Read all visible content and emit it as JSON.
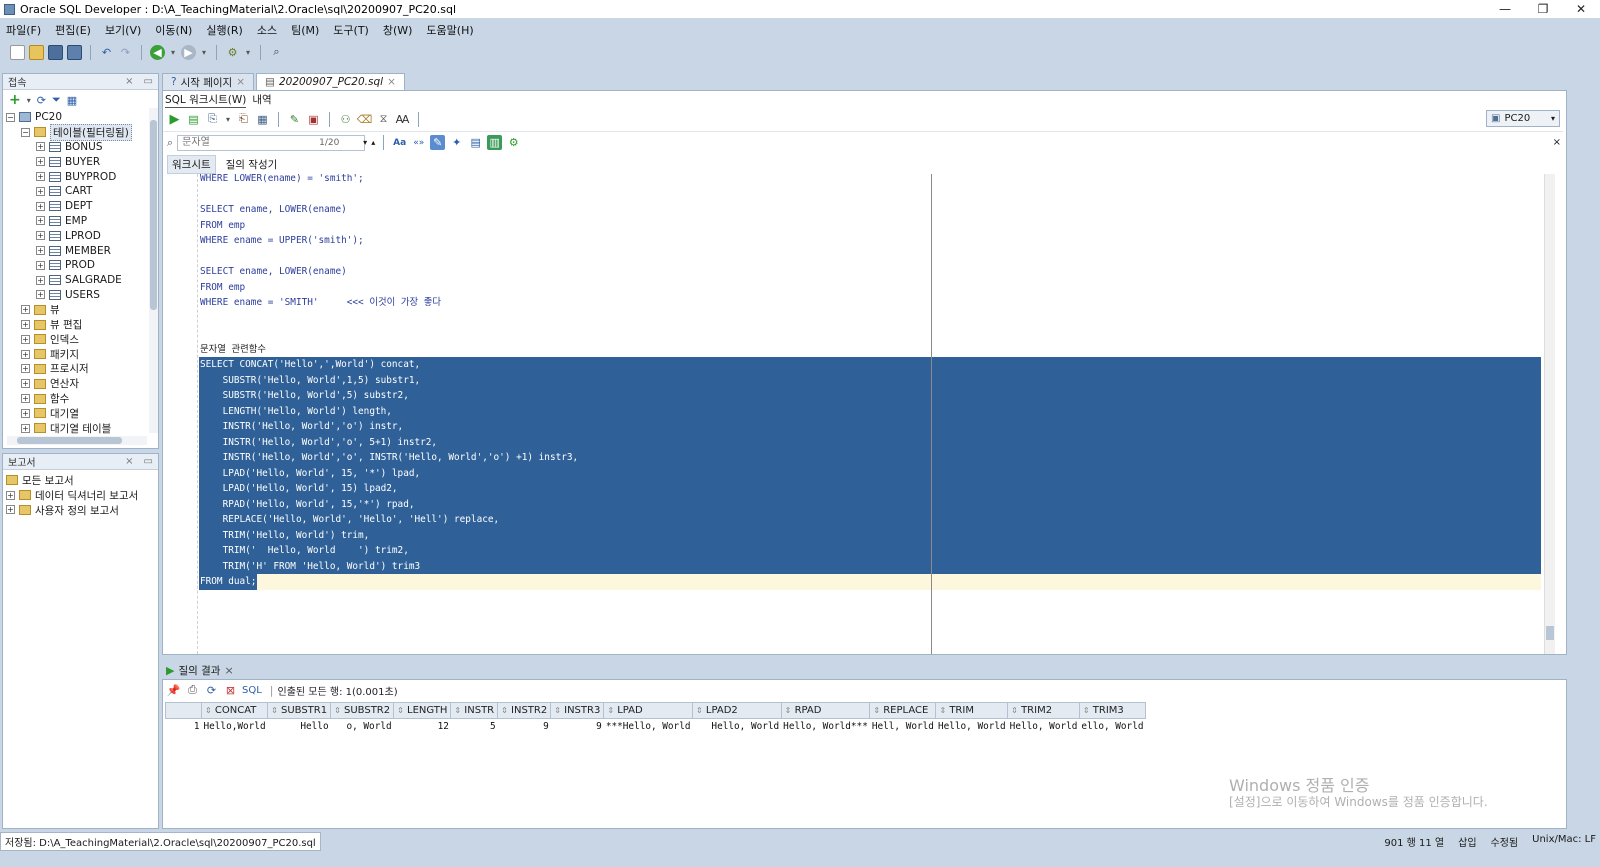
{
  "window": {
    "title": "Oracle SQL Developer : D:\\A_TeachingMaterial\\2.Oracle\\sql\\20200907_PC20.sql",
    "min_label": "—",
    "restore_label": "❐",
    "close_label": "✕"
  },
  "menu": [
    "파일(F)",
    "편집(E)",
    "보기(V)",
    "이동(N)",
    "실행(R)",
    "소스",
    "팀(M)",
    "도구(T)",
    "창(W)",
    "도움말(H)"
  ],
  "connections_panel": {
    "title": "접속",
    "root": "PC20",
    "tables_folder": "테이블(필터링됨)",
    "tables": [
      "BONUS",
      "BUYER",
      "BUYPROD",
      "CART",
      "DEPT",
      "EMP",
      "LPROD",
      "MEMBER",
      "PROD",
      "SALGRADE",
      "USERS"
    ],
    "folders": [
      "뷰",
      "뷰 편집",
      "인덱스",
      "패키지",
      "프로시저",
      "연산자",
      "함수",
      "대기열",
      "대기열 테이블"
    ]
  },
  "reports_panel": {
    "title": "보고서",
    "items": [
      "모든 보고서",
      "데이터 딕셔너리 보고서",
      "사용자 정의 보고서"
    ]
  },
  "editor": {
    "tabs": [
      "시작 페이지",
      "20200907_PC20.sql"
    ],
    "subtabs": [
      "SQL 워크시트(W)",
      "내역"
    ],
    "connection": "PC20",
    "find_placeholder": "문자열",
    "find_count": "1/20",
    "worksheet_tabs": [
      "워크시트",
      "질의 작성기"
    ],
    "lines": [
      {
        "t": "WHERE LOWER(ename) = 'smith';",
        "sel": false
      },
      {
        "t": "",
        "sel": false
      },
      {
        "t": "SELECT ename, LOWER(ename)",
        "sel": false
      },
      {
        "t": "FROM emp",
        "sel": false
      },
      {
        "t": "WHERE ename = UPPER('smith');",
        "sel": false
      },
      {
        "t": "",
        "sel": false
      },
      {
        "t": "SELECT ename, LOWER(ename)",
        "sel": false
      },
      {
        "t": "FROM emp",
        "sel": false
      },
      {
        "t": "WHERE ename = 'SMITH'     <<< 이것이 가장 좋다",
        "sel": false
      },
      {
        "t": "",
        "sel": false
      },
      {
        "t": "",
        "sel": false
      },
      {
        "t": "문자열 관련함수",
        "sel": false
      },
      {
        "t": "SELECT CONCAT('Hello',',World') concat,",
        "sel": true
      },
      {
        "t": "    SUBSTR('Hello, World',1,5) substr1,",
        "sel": true
      },
      {
        "t": "    SUBSTR('Hello, World',5) substr2,",
        "sel": true
      },
      {
        "t": "    LENGTH('Hello, World') length,",
        "sel": true
      },
      {
        "t": "    INSTR('Hello, World','o') instr,",
        "sel": true
      },
      {
        "t": "    INSTR('Hello, World','o', 5+1) instr2,",
        "sel": true
      },
      {
        "t": "    INSTR('Hello, World','o', INSTR('Hello, World','o') +1) instr3,",
        "sel": true
      },
      {
        "t": "    LPAD('Hello, World', 15, '*') lpad,",
        "sel": true
      },
      {
        "t": "    LPAD('Hello, World', 15) lpad2,",
        "sel": true
      },
      {
        "t": "    RPAD('Hello, World', 15,'*') rpad,",
        "sel": true
      },
      {
        "t": "    REPLACE('Hello, World', 'Hello', 'Hell') replace,",
        "sel": true
      },
      {
        "t": "    TRIM('Hello, World') trim,",
        "sel": true
      },
      {
        "t": "    TRIM('  Hello, World    ') trim2,",
        "sel": true
      },
      {
        "t": "    TRIM('H' FROM 'Hello, World') trim3",
        "sel": true
      },
      {
        "t": "FROM dual;",
        "sel": "partial"
      }
    ]
  },
  "results": {
    "tab": "질의 결과",
    "sql_label": "SQL",
    "status": "인출된 모든 행: 1(0.001초)",
    "columns": [
      "CONCAT",
      "SUBSTR1",
      "SUBSTR2",
      "LENGTH",
      "INSTR",
      "INSTR2",
      "INSTR3",
      "LPAD",
      "LPAD2",
      "RPAD",
      "REPLACE",
      "TRIM",
      "TRIM2",
      "TRIM3"
    ],
    "rows": [
      [
        "1",
        "Hello,World",
        "Hello",
        "o, World",
        "12",
        "5",
        "9",
        "9",
        "***Hello, World",
        "   Hello, World",
        "Hello, World***",
        "Hell, World",
        "Hello, World",
        "Hello, World",
        "ello, World"
      ]
    ]
  },
  "watermark": {
    "line1": "Windows 정품 인증",
    "line2": "[설정]으로 이동하여 Windows를 정품 인증합니다."
  },
  "statusbar": {
    "path": "저장됨: D:\\A_TeachingMaterial\\2.Oracle\\sql\\20200907_PC20.sql",
    "position": "901 행 11 열",
    "insert_mode": "삽입",
    "modified": "수정됨",
    "line_endings": "Unix/Mac: LF"
  },
  "colors": {
    "chrome": "#c8d6e5",
    "selection": "#2f6198",
    "current_line": "#fdf7de"
  }
}
